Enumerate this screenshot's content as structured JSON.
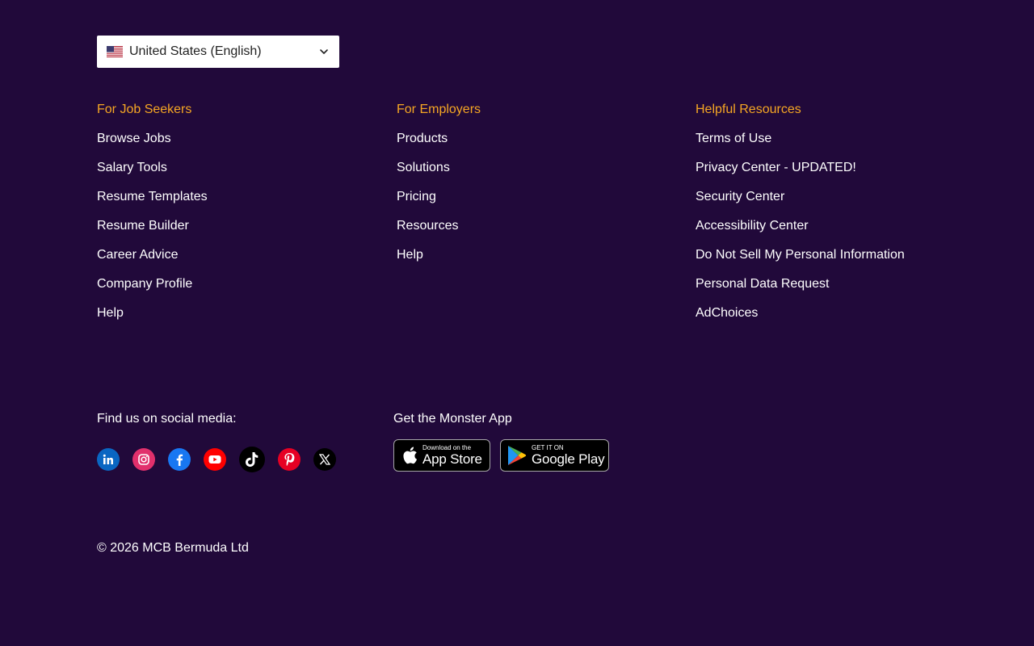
{
  "locale": {
    "label": "United States (English)"
  },
  "columns": [
    {
      "title": "For Job Seekers",
      "links": [
        "Browse Jobs",
        "Salary Tools",
        "Resume Templates",
        "Resume Builder",
        "Career Advice",
        "Company Profile",
        "Help"
      ]
    },
    {
      "title": "For Employers",
      "links": [
        "Products",
        "Solutions",
        "Pricing",
        "Resources",
        "Help"
      ]
    },
    {
      "title": "Helpful Resources",
      "links": [
        "Terms of Use",
        "Privacy Center - UPDATED!",
        "Security Center",
        "Accessibility Center",
        "Do Not Sell My Personal Information",
        "Personal Data Request",
        "AdChoices"
      ]
    }
  ],
  "social": {
    "title": "Find us on social media:",
    "icons": [
      {
        "name": "linkedin-icon",
        "color": "#0a66c2"
      },
      {
        "name": "instagram-icon",
        "color": "#e1306c"
      },
      {
        "name": "facebook-icon",
        "color": "#1877f2"
      },
      {
        "name": "youtube-icon",
        "color": "#ff0000"
      },
      {
        "name": "tiktok-icon",
        "color": "#000000"
      },
      {
        "name": "pinterest-icon",
        "color": "#e60023"
      },
      {
        "name": "x-icon",
        "color": "#000000"
      }
    ]
  },
  "app": {
    "title": "Get the Monster App",
    "apple_small": "Download on the",
    "apple_big": "App Store",
    "google_small": "GET IT ON",
    "google_big": "Google Play"
  },
  "copyright": "© 2026 MCB Bermuda Ltd",
  "colors": {
    "background": "#21093a",
    "heading": "#f5a623",
    "text": "#ffffff"
  }
}
